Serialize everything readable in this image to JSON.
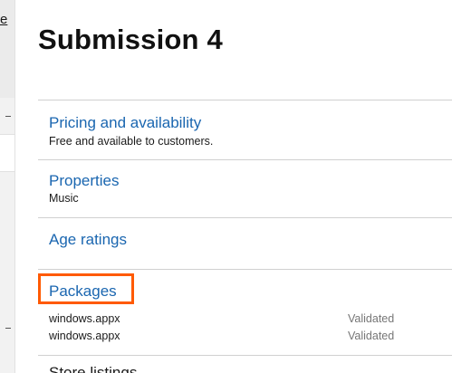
{
  "nav": {
    "top_link_letter": "e"
  },
  "page": {
    "title": "Submission 4"
  },
  "sections": {
    "pricing": {
      "title": "Pricing and availability",
      "subtitle": "Free and available to customers."
    },
    "properties": {
      "title": "Properties",
      "subtitle": "Music"
    },
    "age_ratings": {
      "title": "Age ratings"
    },
    "packages": {
      "title": "Packages",
      "items": [
        {
          "name": "windows.appx",
          "status": "Validated"
        },
        {
          "name": "windows.appx",
          "status": "Validated"
        }
      ]
    },
    "store_listings": {
      "title": "Store listings"
    }
  },
  "colors": {
    "link": "#1a66b0",
    "highlight": "#ff5a00"
  }
}
